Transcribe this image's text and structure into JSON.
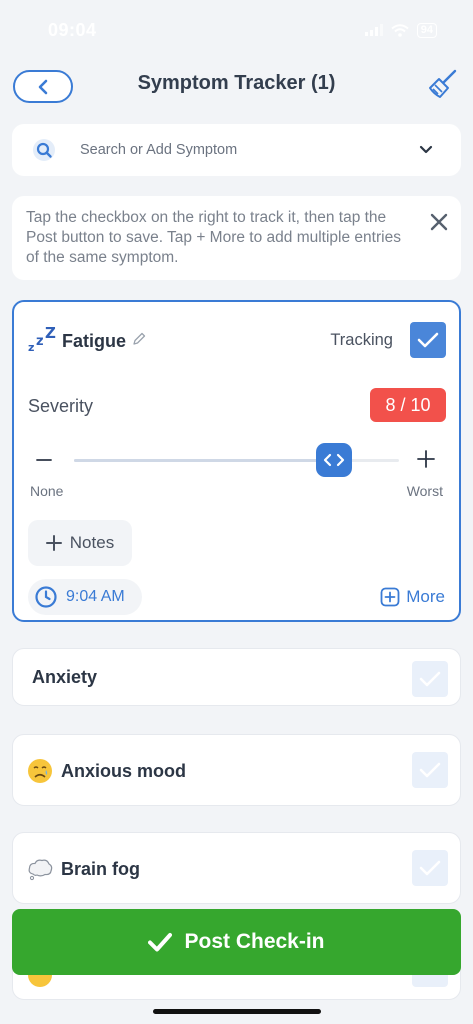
{
  "status_bar": {
    "time": "09:04",
    "battery": "94"
  },
  "header": {
    "title": "Symptom Tracker (1)"
  },
  "search": {
    "placeholder": "Search or Add Symptom"
  },
  "tip": {
    "text": "Tap the checkbox on the right to track it, then tap the Post button to save. Tap + More to add multiple entries of the same symptom."
  },
  "active_symptom": {
    "name": "Fatigue",
    "tracking_label": "Tracking",
    "severity_label": "Severity",
    "severity_value": "8 / 10",
    "severity_fraction": 0.8,
    "scale_min": "None",
    "scale_max": "Worst",
    "notes_label": "Notes",
    "time": "9:04 AM",
    "more_label": "More"
  },
  "symptoms": [
    {
      "name": "Anxiety",
      "icon": ""
    },
    {
      "name": "Anxious mood",
      "icon": "anxious-face-icon"
    },
    {
      "name": "Brain fog",
      "icon": "thought-cloud-icon"
    }
  ],
  "post_button": {
    "label": "Post Check-in"
  },
  "colors": {
    "accent": "#3a7bd5",
    "severity_badge": "#f2514b",
    "post": "#36a72e"
  }
}
